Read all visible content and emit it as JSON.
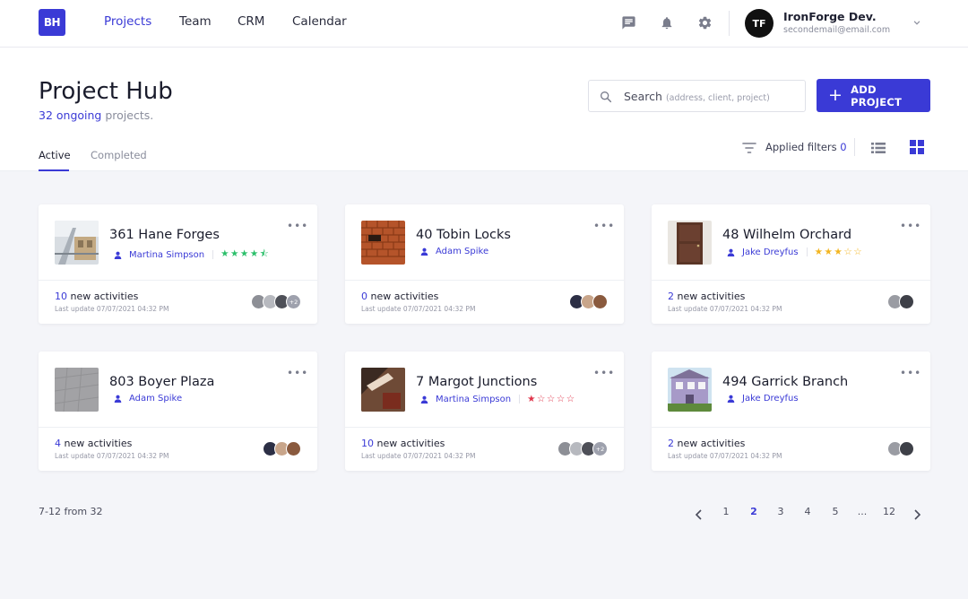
{
  "nav": {
    "logo": "BH",
    "links": [
      "Projects",
      "Team",
      "CRM",
      "Calendar"
    ],
    "user": {
      "initials": "TF",
      "name": "IronForge Dev.",
      "email": "secondemail@email.com"
    },
    "icons": [
      "chat-icon",
      "bell-icon",
      "gear-icon"
    ]
  },
  "header": {
    "title": "Project Hub",
    "ongoing_count": "32 ongoing",
    "ongoing_suffix": " projects.",
    "search_label": "Search",
    "search_hint": "(address, client, project)",
    "add_button": "ADD PROJECT",
    "tabs": [
      "Active",
      "Completed"
    ],
    "filters_label": "Applied filters",
    "filters_count": "0"
  },
  "projects": [
    {
      "title": "361 Hane Forges",
      "owner": "Martina Simpson",
      "rating": "★★★★⯪",
      "rating_color": "#2bbf6a",
      "activities": "10",
      "activities_label": " new activities",
      "updated": "Last update 07/07/2021 04:32 PM",
      "more": "+2"
    },
    {
      "title": "40 Tobin Locks",
      "owner": "Adam Spike",
      "rating": "",
      "rating_color": "#2bbf6a",
      "activities": "0",
      "activities_label": " new activities",
      "updated": "Last update 07/07/2021 04:32 PM",
      "more": ""
    },
    {
      "title": "48 Wilhelm Orchard",
      "owner": "Jake Dreyfus",
      "rating": "★★★☆☆",
      "rating_color": "#f3b520",
      "activities": "2",
      "activities_label": " new activities",
      "updated": "Last update 07/07/2021 04:32 PM",
      "more": ""
    },
    {
      "title": "803 Boyer Plaza",
      "owner": "Adam Spike",
      "rating": "",
      "rating_color": "#2bbf6a",
      "activities": "4",
      "activities_label": " new activities",
      "updated": "Last update 07/07/2021 04:32 PM",
      "more": ""
    },
    {
      "title": "7 Margot Junctions",
      "owner": "Martina Simpson",
      "rating": "★☆☆☆☆",
      "rating_color": "#e0344a",
      "activities": "10",
      "activities_label": " new activities",
      "updated": "Last update 07/07/2021 04:32 PM",
      "more": "+2"
    },
    {
      "title": "494 Garrick Branch",
      "owner": "Jake Dreyfus",
      "rating": "",
      "rating_color": "#2bbf6a",
      "activities": "2",
      "activities_label": " new activities",
      "updated": "Last update 07/07/2021 04:32 PM",
      "more": ""
    }
  ],
  "pagination": {
    "range": "7-12 from 32",
    "pages": [
      "1",
      "2",
      "3",
      "4",
      "5",
      "...",
      "12"
    ],
    "active": "2"
  }
}
